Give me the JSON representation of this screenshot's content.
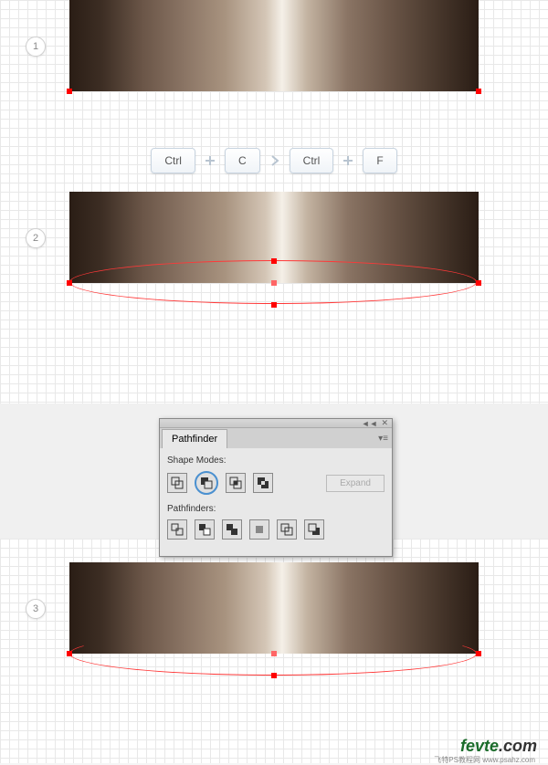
{
  "steps": {
    "one": "1",
    "two": "2",
    "three": "3"
  },
  "shortcut": {
    "ctrl1": "Ctrl",
    "c": "C",
    "ctrl2": "Ctrl",
    "f": "F"
  },
  "panel": {
    "title": "Pathfinder",
    "shape_modes_label": "Shape Modes:",
    "pathfinders_label": "Pathfinders:",
    "expand": "Expand",
    "collapse": "◄◄",
    "close": "✕"
  },
  "watermark": {
    "brand1": "fevte",
    "brand2": ".com",
    "sub": "飞特PS教程网\nwww.psahz.com"
  }
}
